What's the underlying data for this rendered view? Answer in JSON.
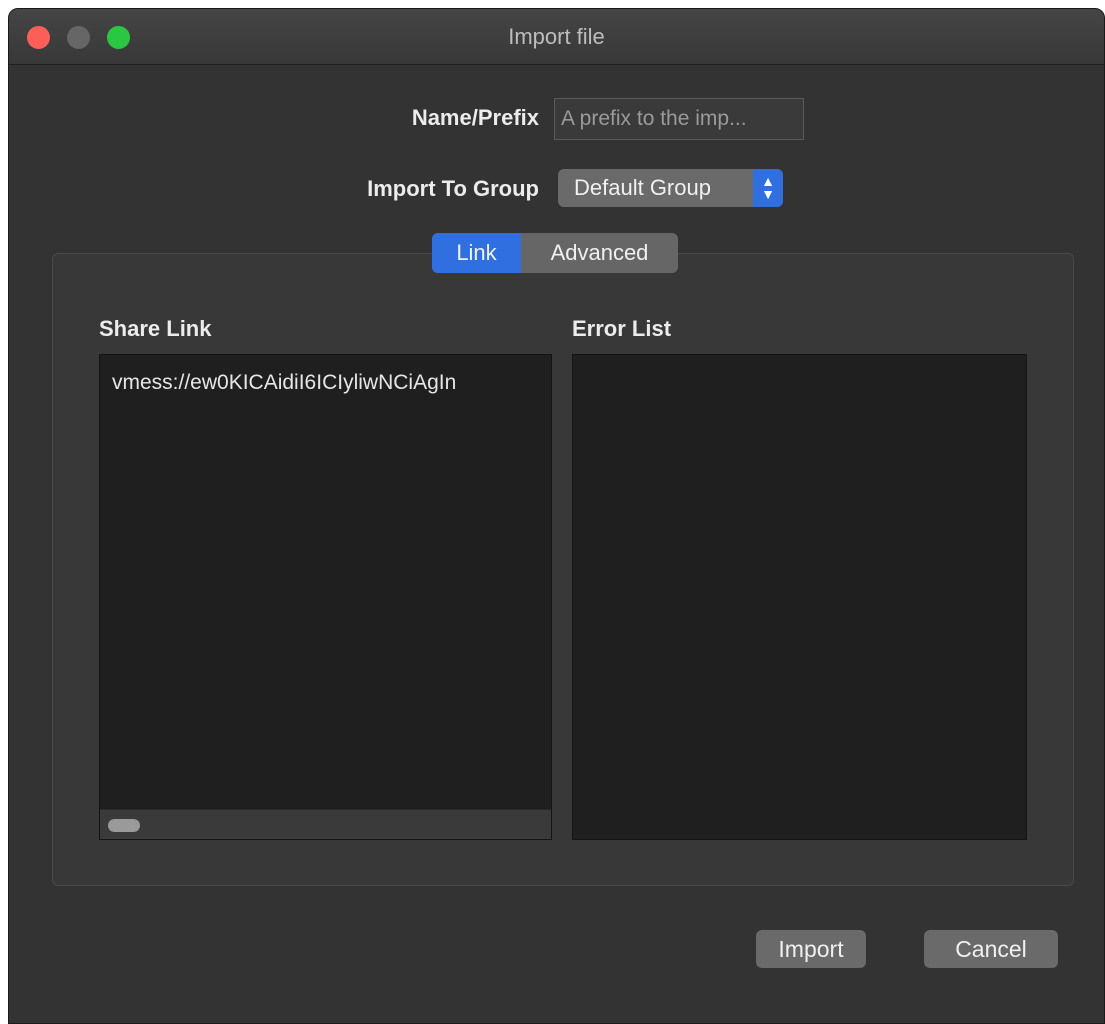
{
  "window": {
    "title": "Import file"
  },
  "form": {
    "name_prefix_label": "Name/Prefix",
    "name_prefix_placeholder": "A prefix to the imp...",
    "import_to_group_label": "Import To Group",
    "group_selected": "Default Group"
  },
  "tabs": [
    {
      "label": "Link",
      "active": true
    },
    {
      "label": "Advanced",
      "active": false
    }
  ],
  "link_tab": {
    "share_link_label": "Share Link",
    "share_link_value": "vmess://ew0KICAidiI6ICIyliwNCiAgIn",
    "error_list_label": "Error List"
  },
  "buttons": {
    "import": "Import",
    "cancel": "Cancel"
  },
  "colors": {
    "accent": "#2f6fe0",
    "close": "#fc5f57",
    "maximize": "#2ac842"
  }
}
